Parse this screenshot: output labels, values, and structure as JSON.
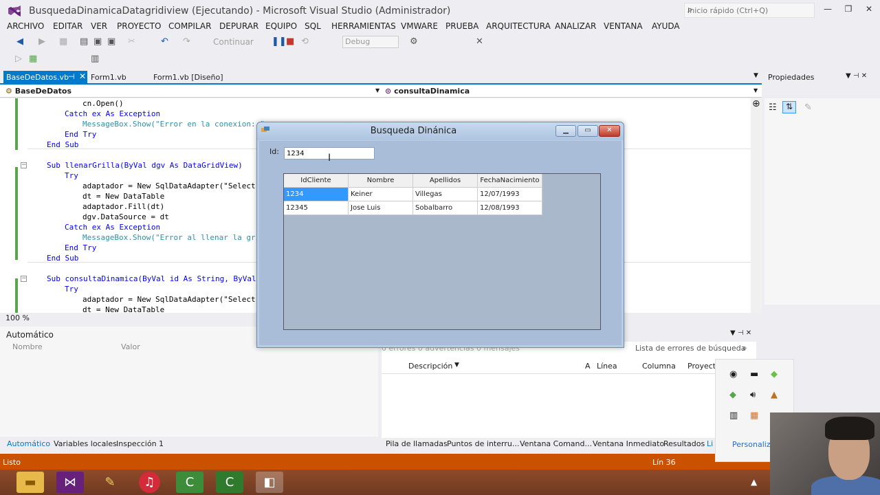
{
  "window": {
    "title": "BusquedaDinamicaDatagridiview (Ejecutando) - Microsoft Visual Studio (Administrador)",
    "quick_launch_placeholder": "Inicio rápido (Ctrl+Q)"
  },
  "menu": [
    "ARCHIVO",
    "EDITAR",
    "VER",
    "PROYECTO",
    "COMPILAR",
    "DEPURAR",
    "EQUIPO",
    "SQL",
    "HERRAMIENTAS",
    "VMWARE",
    "PRUEBA",
    "ARQUITECTURA",
    "ANALIZAR",
    "VENTANA",
    "AYUDA"
  ],
  "toolbar": {
    "continue_label": "Continuar",
    "configuration": "Debug"
  },
  "doc_tabs": {
    "active": "BaseDeDatos.vb",
    "tab2": "Form1.vb",
    "tab3": "Form1.vb [Diseño]"
  },
  "nav": {
    "left": "BaseDeDatos",
    "right": "consultaDinamica"
  },
  "editor": {
    "zoom": "100 %",
    "lines": [
      "cn.Open()",
      "Catch ex As Exception",
      "MessageBox.Show(\"Error en la conexion: \"",
      "End Try",
      "End Sub",
      "Sub llenarGrilla(ByVal dgv As DataGridView)",
      "Try",
      "adaptador = New SqlDataAdapter(\"Select",
      "dt = New DataTable",
      "adaptador.Fill(dt)",
      "dgv.DataSource = dt",
      "Catch ex As Exception",
      "MessageBox.Show(\"Error al llenar la gri",
      "End Try",
      "End Sub",
      "Sub consultaDinamica(ByVal id As String, ByVal",
      "Try",
      "adaptador = New SqlDataAdapter(\"Select",
      "dt = New DataTable"
    ]
  },
  "properties": {
    "title": "Propiedades"
  },
  "dialog": {
    "title": "Busqueda Dinánica",
    "id_label": "Id:",
    "id_value": "1234",
    "columns": [
      "IdCliente",
      "Nombre",
      "Apellidos",
      "FechaNacimiento"
    ],
    "rows": [
      [
        "1234",
        "Keiner",
        "Villegas",
        "12/07/1993"
      ],
      [
        "12345",
        "Jose Luis",
        "Sobalbarro",
        "12/08/1993"
      ]
    ]
  },
  "autos": {
    "title": "Automático",
    "col_name": "Nombre",
    "col_value": "Valor"
  },
  "errors": {
    "filters": "0 errores   0 advertencias   0 mensajes",
    "search_placeholder": "Lista de errores de búsqueda",
    "columns": {
      "description": "Descripción",
      "file_marker": "A",
      "line": "Línea",
      "column": "Columna",
      "project": "Proyect"
    }
  },
  "bottom_tabs_left": [
    "Automático",
    "Variables locales",
    "Inspección 1"
  ],
  "bottom_tabs_right": [
    "Pila de llamadas",
    "Puntos de interru...",
    "Ventana Comand...",
    "Ventana Inmediato",
    "Resultados",
    "Li"
  ],
  "status": {
    "text": "Listo",
    "line": "Lín 36"
  },
  "tray": {
    "personaliza": "Personaliza"
  },
  "colors": {
    "accent": "#007acc",
    "status_debug": "#ca5100",
    "selection": "#3399ff"
  }
}
